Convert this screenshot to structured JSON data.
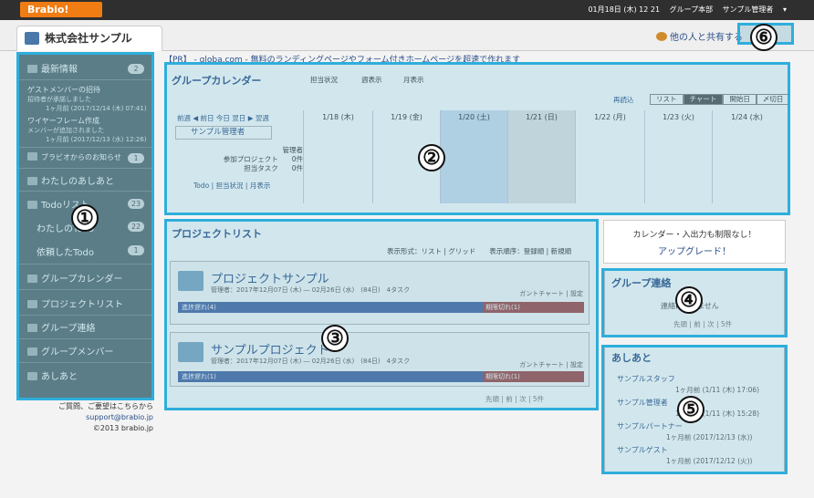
{
  "topbar": {
    "logo": "Brabio!",
    "datetime": "01月18日 (木) 12 21",
    "group_user": "グループ本部",
    "user": "サンプル管理者"
  },
  "header": {
    "company": "株式会社サンプル",
    "share": "他の人と共有する"
  },
  "promo": "【PR】 - globa.com - 無料のランディングページやフォーム付きホームページを超速で作れます",
  "sidebar": {
    "latest": {
      "label": "最新情報",
      "count": "2"
    },
    "news": [
      {
        "title": "ゲストメンバーの招待",
        "desc": "招待者が承諾しました",
        "time": "1ヶ月前 (2017/12/14 (木) 07:41)"
      },
      {
        "title": "ワイヤーフレーム作成",
        "desc": "メンバーが追加されました",
        "time": "1ヶ月前 (2017/12/13 (水) 12:26)"
      }
    ],
    "notice": {
      "label": "ブラビオからのお知らせ",
      "count": "1"
    },
    "ashiato": "わたしのあしあと",
    "todo": {
      "label": "Todoリスト",
      "count": "23"
    },
    "my_todo": {
      "label": "わたしのTodo",
      "count": "22"
    },
    "req_todo": {
      "label": "依頼したTodo",
      "count": "1"
    },
    "nav": [
      "グループカレンダー",
      "プロジェクトリスト",
      "グループ連絡",
      "グループメンバー",
      "あしあと"
    ]
  },
  "footer": {
    "contact": "ご質問、ご要望はこちらから",
    "email": "support@brabio.jp",
    "copyright": "©2013 brabio.jp"
  },
  "calendar": {
    "title": "グループカレンダー",
    "tabs": [
      "担当状況",
      "週表示",
      "月表示"
    ],
    "reload": "再読込",
    "views": [
      "リスト",
      "チャート",
      "開始日",
      "〆切日"
    ],
    "nav": "前週 ◀ 前日 今日 翌日 ▶ 翌週",
    "dates": [
      "1/18 (木)",
      "1/19 (金)",
      "1/20 (土)",
      "1/21 (日)",
      "1/22 (月)",
      "1/23 (火)",
      "1/24 (水)"
    ],
    "member": "サンプル管理者",
    "role": "管理者",
    "projects": "参加プロジェクト　　0件",
    "tasks": "担当タスク　　0件",
    "links": "Todo | 担当状況 | 月表示"
  },
  "projects": {
    "title": "プロジェクトリスト",
    "display": "表示形式：リスト | グリッド　　表示順序：登録順 | 新規順",
    "items": [
      {
        "name": "プロジェクトサンプル",
        "meta": "管理者：2017年12月07日 (木) ― 02月26日 (水)　(84日)　4タスク",
        "late": "進捗遅れ(4)",
        "over": "期限切れ(1)"
      },
      {
        "name": "サンプルプロジェクト",
        "meta": "管理者：2017年12月07日 (木) ― 02月26日 (水)　(84日)　4タスク",
        "late": "進捗遅れ(1)",
        "over": "期限切れ(1)"
      }
    ],
    "tools": "ガントチャート | 設定",
    "pager": "先頭 | 前 | 次 | 5件"
  },
  "upgrade": {
    "line1": "カレンダー・入出力も制限なし！",
    "line2": "アップグレード！"
  },
  "group_contact": {
    "title": "グループ連絡",
    "text": "連絡はありません",
    "pager": "先頭 | 前 | 次 | 5件"
  },
  "ashiato": {
    "title": "あしあと",
    "rows": [
      {
        "name": "サンプルスタッフ",
        "time": "1ヶ月前 (1/11 (木) 17:06)"
      },
      {
        "name": "サンプル管理者",
        "time": "1ヶ月前 (1/11 (木) 15:28)"
      },
      {
        "name": "サンプルパートナー",
        "time": "1ヶ月前 (2017/12/13 (水))"
      },
      {
        "name": "サンプルゲスト",
        "time": "1ヶ月前 (2017/12/12 (火))"
      }
    ]
  },
  "badges": [
    "①",
    "②",
    "③",
    "④",
    "⑤",
    "⑥"
  ],
  "colors": {
    "highlight": "#2eaedc",
    "sidebar": "#5a6d72",
    "late_bar": "#4a67a5",
    "over_bar": "#a24a4a",
    "logo": "#f07d14"
  }
}
